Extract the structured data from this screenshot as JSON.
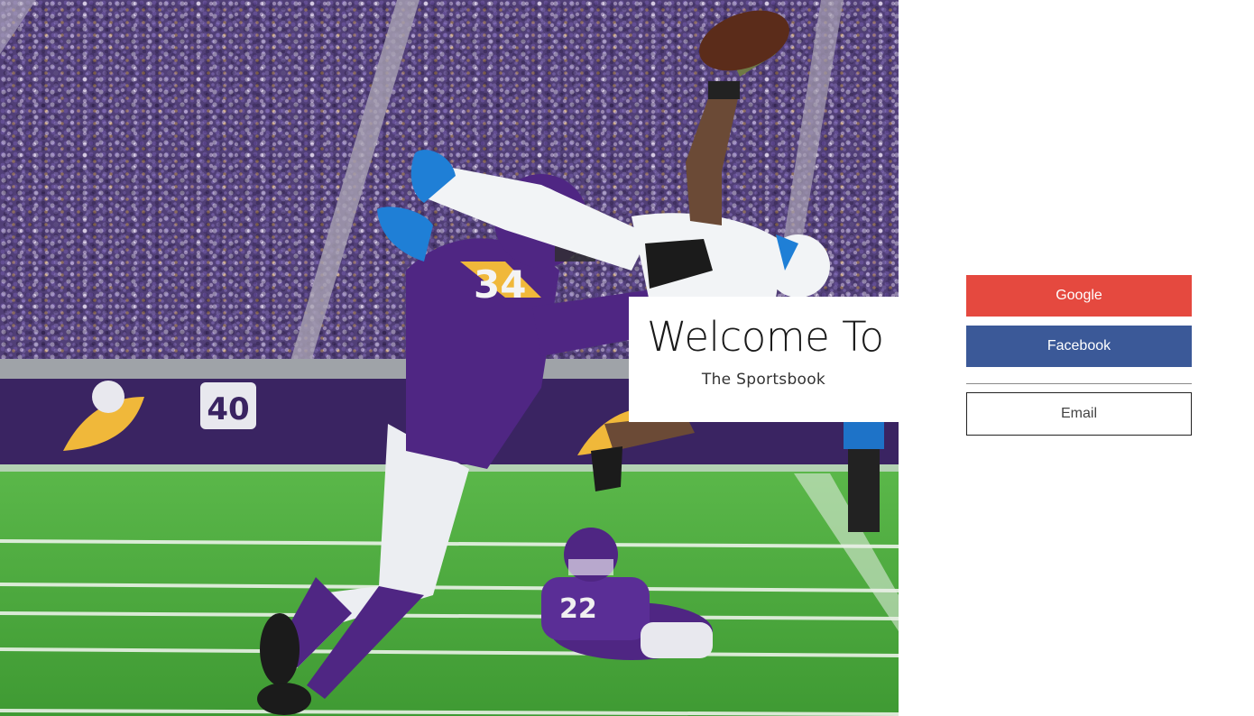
{
  "hero": {
    "image_name": "football-touchdown-photo"
  },
  "welcome": {
    "title": "Welcome To",
    "subtitle": "The Sportsbook"
  },
  "login": {
    "google_label": "Google",
    "facebook_label": "Facebook",
    "email_label": "Email"
  },
  "colors": {
    "google": "#e5493f",
    "facebook": "#3b5998",
    "vikings_purple": "#4f2683",
    "lions_blue": "#0076b6",
    "field_green": "#4caf3a"
  }
}
